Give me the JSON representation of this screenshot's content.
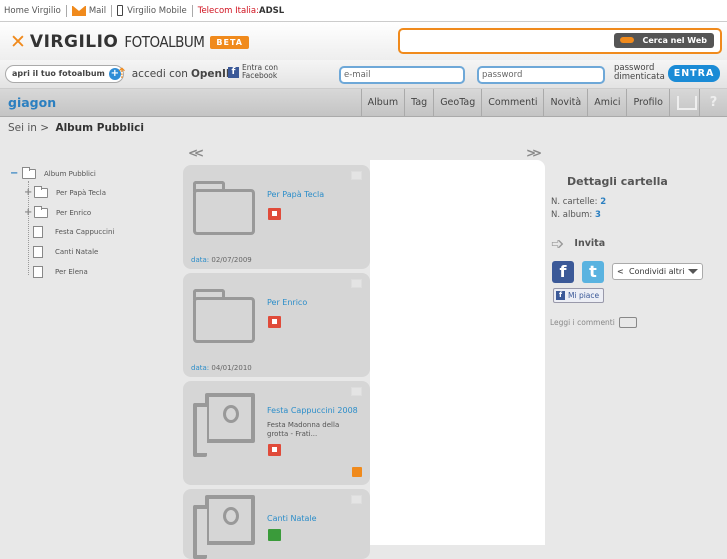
{
  "toplinks": {
    "home": "Home Virgilio",
    "mail": "Mail",
    "mobile": "Virgilio Mobile",
    "telecom": "Telecom Italia:",
    "adsl": "ADSL"
  },
  "header": {
    "logo_main": "VIRGILIO",
    "logo_sub": "FOTOALBUM",
    "beta": "BETA",
    "search_button": "Cerca nel Web"
  },
  "login": {
    "open_album": "apri il tuo fotoalbum",
    "openid_prefix": "accedi con",
    "openid": "OpenID",
    "facebook": "Entra con Facebook",
    "email_placeholder": "e-mail",
    "password_placeholder": "password",
    "forgot": "password dimenticata",
    "enter": "ENTRA"
  },
  "nav": {
    "user": "giagon",
    "tabs": [
      "Album",
      "Tag",
      "GeoTag",
      "Commenti",
      "Novità",
      "Amici",
      "Profilo"
    ],
    "help": "?"
  },
  "breadcrumb": {
    "prefix": "Sei in",
    "current": "Album Pubblici"
  },
  "tree": {
    "root": "Album Pubblici",
    "items": [
      "Per Papà Tecla",
      "Per Enrico",
      "Festa Cappuccini",
      "Canti Natale",
      "Per Elena"
    ]
  },
  "cards": [
    {
      "title": "Per Papà Tecla",
      "date_label": "data:",
      "date": "02/07/2009"
    },
    {
      "title": "Per Enrico",
      "date_label": "data:",
      "date": "04/01/2010"
    },
    {
      "title": "Festa Cappuccini 2008",
      "desc": "Festa Madonna della grotta - Frati..."
    },
    {
      "title": "Canti Natale"
    }
  ],
  "details": {
    "title": "Dettagli cartella",
    "folders_label": "N. cartelle:",
    "folders": "2",
    "albums_label": "N. album:",
    "albums": "3",
    "invite": "Invita",
    "share_more": "Condividi altri",
    "like": "Mi piace",
    "comments": "Leggi i commenti"
  },
  "colors": {
    "accent": "#f08a1c",
    "link": "#2b7fc0",
    "enter_button": "#1a8bd6"
  }
}
